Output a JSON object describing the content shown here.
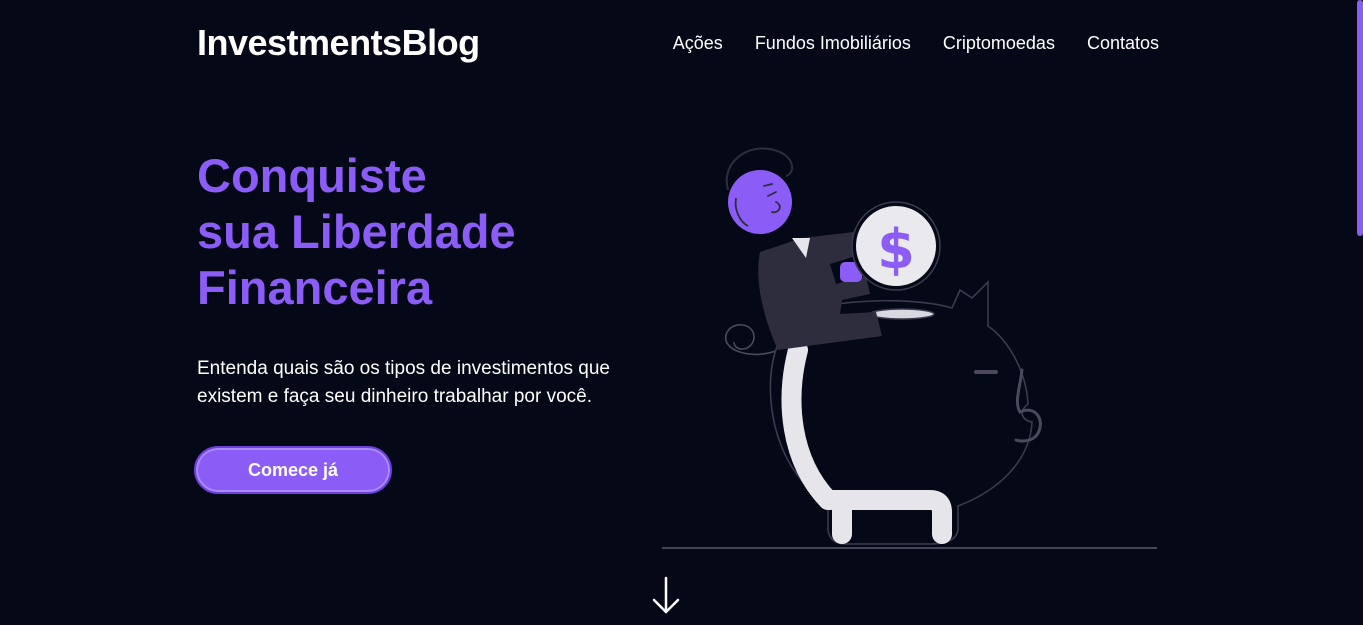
{
  "header": {
    "logo": "InvestmentsBlog",
    "nav": [
      {
        "label": "Ações"
      },
      {
        "label": "Fundos Imobiliários"
      },
      {
        "label": "Criptomoedas"
      },
      {
        "label": "Contatos"
      }
    ]
  },
  "hero": {
    "headline": [
      "Conquiste",
      "sua Liberdade",
      "Financeira"
    ],
    "description": "Entenda quais são os tipos de investimentos que existem e faça seu dinheiro trabalhar por você.",
    "cta_label": "Comece já",
    "coin_symbol": "$"
  },
  "icons": {
    "illustration": "person-piggy-bank-icon",
    "scroll": "arrow-down-icon"
  },
  "colors": {
    "background": "#050816",
    "accent": "#8b5cf6",
    "text": "#ffffff"
  }
}
